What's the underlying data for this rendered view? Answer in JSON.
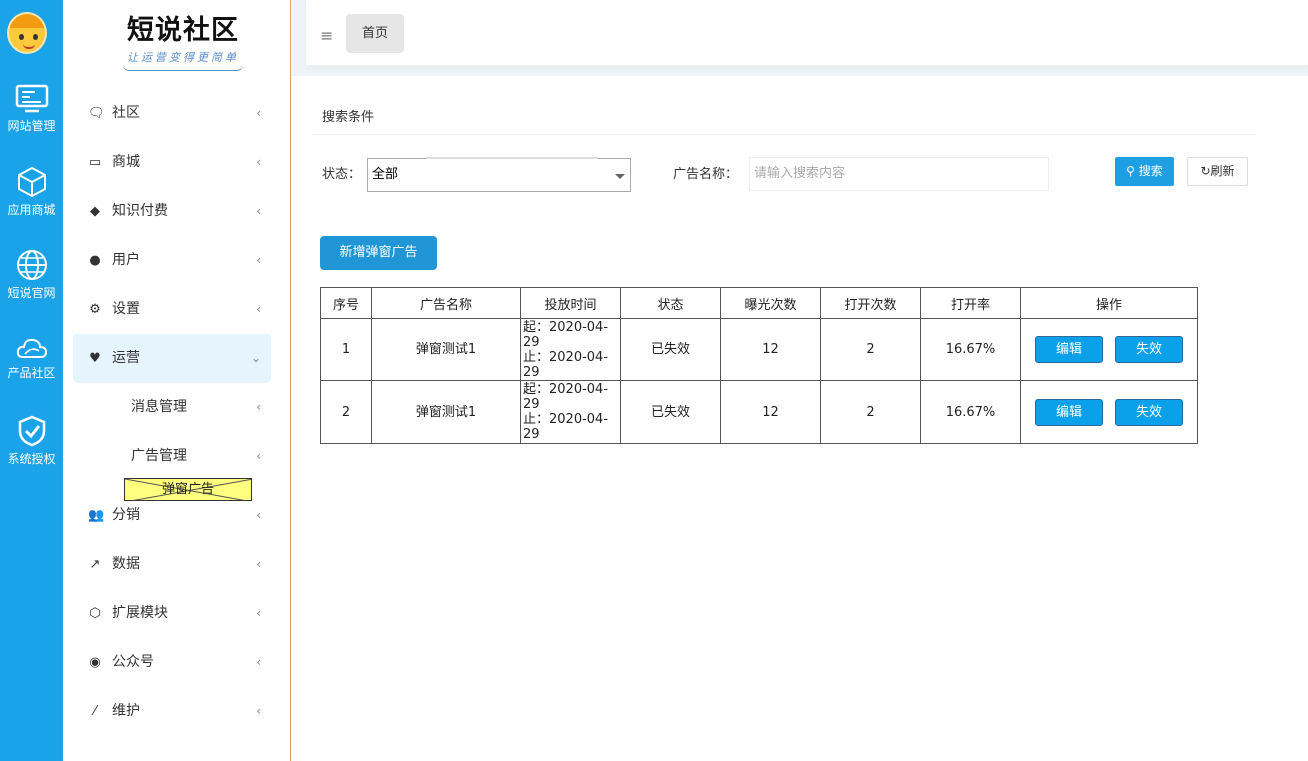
{
  "rail": {
    "items": [
      {
        "label": "网站管理",
        "icon": "monitor-icon"
      },
      {
        "label": "应用商城",
        "icon": "cube-icon"
      },
      {
        "label": "短说官网",
        "icon": "globe-icon"
      },
      {
        "label": "产品社区",
        "icon": "cloud-icon"
      },
      {
        "label": "系统授权",
        "icon": "shield-check-icon"
      }
    ]
  },
  "logo": {
    "title": "短说社区",
    "slogan": "让运营变得更简单"
  },
  "sidebar": {
    "items": [
      {
        "label": "社区",
        "icon": "comment-icon"
      },
      {
        "label": "商城",
        "icon": "laptop-icon"
      },
      {
        "label": "知识付费",
        "icon": "graduation-cap-icon"
      },
      {
        "label": "用户",
        "icon": "user-icon"
      },
      {
        "label": "设置",
        "icon": "gear-icon"
      },
      {
        "label": "运营",
        "icon": "heartbeat-icon"
      },
      {
        "label": "分销",
        "icon": "users-icon"
      },
      {
        "label": "数据",
        "icon": "line-chart-icon"
      },
      {
        "label": "扩展模块",
        "icon": "cube-outline-icon"
      },
      {
        "label": "公众号",
        "icon": "wechat-icon"
      },
      {
        "label": "维护",
        "icon": "magic-wand-icon"
      }
    ],
    "sub": [
      {
        "label": "消息管理"
      },
      {
        "label": "广告管理"
      }
    ],
    "highlighted": "弹窗广告"
  },
  "topbar": {
    "tab": "首页"
  },
  "search": {
    "title": "搜索条件",
    "status_label": "状态：",
    "status_value": "全部",
    "name_label": "广告名称：",
    "name_placeholder": "请输入搜索内容",
    "search_btn": "搜索",
    "refresh_btn": "刷新"
  },
  "add_btn": "新增弹窗广告",
  "table": {
    "headers": [
      "序号",
      "广告名称",
      "投放时间",
      "状态",
      "曝光次数",
      "打开次数",
      "打开率",
      "操作"
    ],
    "rows": [
      {
        "id": "1",
        "name": "弹窗测试1",
        "start": "起：2020-04-29",
        "end": "止：2020-04-29",
        "status": "已失效",
        "views": "12",
        "opens": "2",
        "rate": "16.67%",
        "edit": "编辑",
        "disable": "失效"
      },
      {
        "id": "2",
        "name": "弹窗测试1",
        "start": "起：2020-04-29",
        "end": "止：2020-04-29",
        "status": "已失效",
        "views": "12",
        "opens": "2",
        "rate": "16.67%",
        "edit": "编辑",
        "disable": "失效"
      }
    ]
  },
  "colors": {
    "rail": "#1aa3e8",
    "primary": "#1e9fe3",
    "active_bg": "#e5f4fd"
  }
}
